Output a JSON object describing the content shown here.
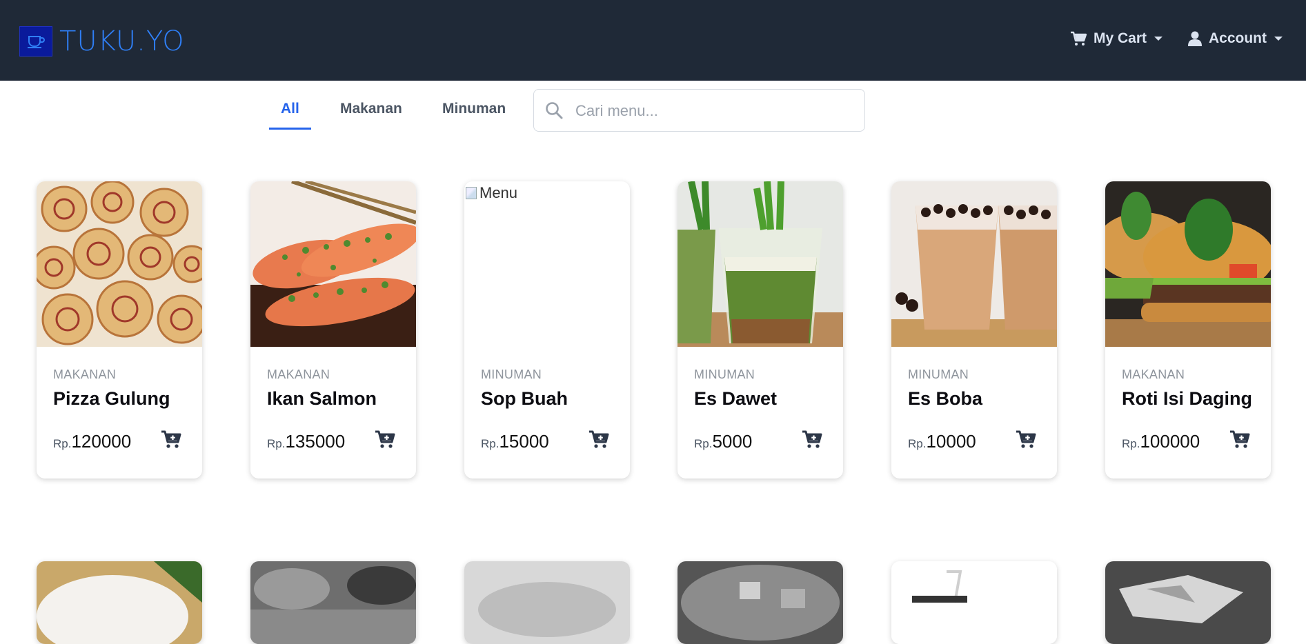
{
  "brand": {
    "name": "TUKU.YO",
    "icon": "cup-icon"
  },
  "header": {
    "cart_label": "My Cart",
    "account_label": "Account"
  },
  "tabs": [
    {
      "label": "All",
      "active": true
    },
    {
      "label": "Makanan",
      "active": false
    },
    {
      "label": "Minuman",
      "active": false
    }
  ],
  "search": {
    "placeholder": "Cari menu...",
    "value": ""
  },
  "currency_prefix": "Rp.",
  "menu": [
    {
      "category": "MAKANAN",
      "name": "Pizza Gulung",
      "price": "120000",
      "image": "pizza-rolls"
    },
    {
      "category": "MAKANAN",
      "name": "Ikan Salmon",
      "price": "135000",
      "image": "salmon"
    },
    {
      "category": "MINUMAN",
      "name": "Sop Buah",
      "price": "15000",
      "image": "broken",
      "alt": "Menu"
    },
    {
      "category": "MINUMAN",
      "name": "Es Dawet",
      "price": "5000",
      "image": "dawet"
    },
    {
      "category": "MINUMAN",
      "name": "Es Boba",
      "price": "10000",
      "image": "boba"
    },
    {
      "category": "MAKANAN",
      "name": "Roti Isi Daging",
      "price": "100000",
      "image": "burger"
    }
  ],
  "colors": {
    "header_bg": "#1f2937",
    "accent": "#2563eb",
    "brand": "#2f7ff6"
  }
}
